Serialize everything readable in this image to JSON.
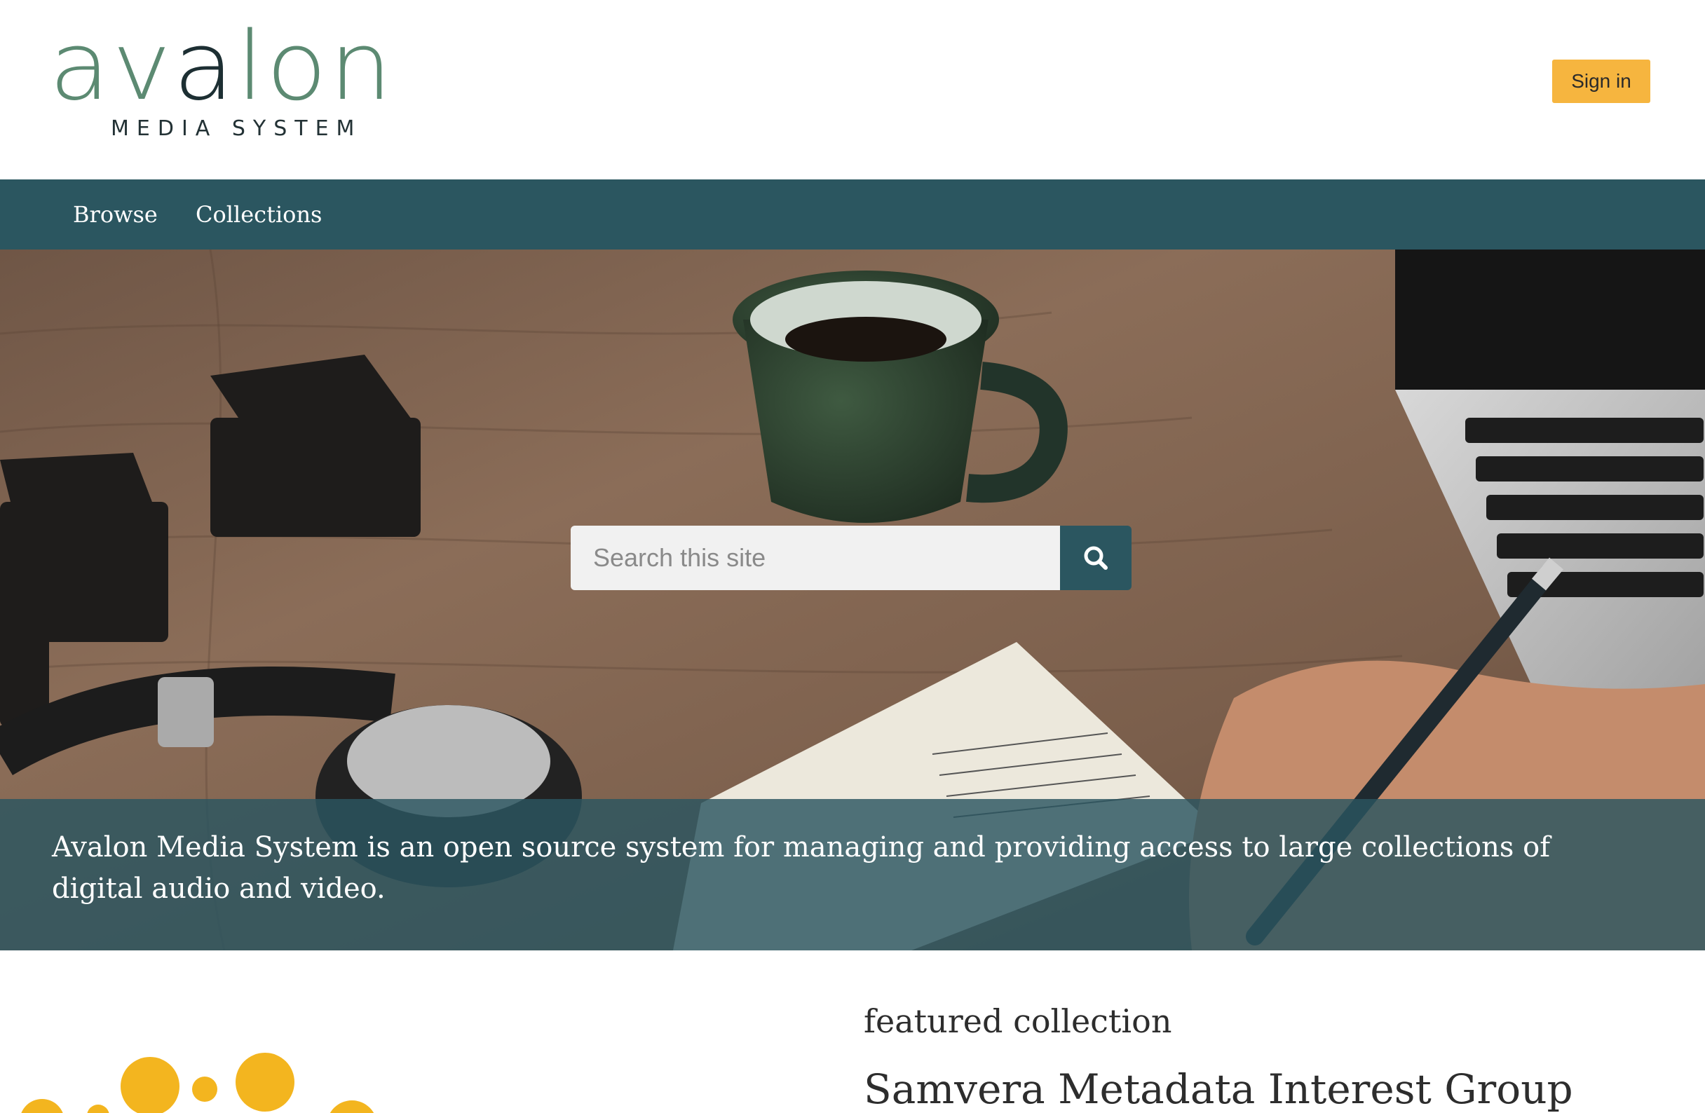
{
  "logo": {
    "word_light_1": "av",
    "word_dark": "a",
    "word_light_2": "lon",
    "subtitle": "MEDIA SYSTEM"
  },
  "header": {
    "signin_label": "Sign in"
  },
  "nav": {
    "items": [
      {
        "label": "Browse"
      },
      {
        "label": "Collections"
      }
    ]
  },
  "search": {
    "placeholder": "Search this site",
    "icon": "search-icon"
  },
  "banner": {
    "text": "Avalon Media System is an open source system for managing and providing access to large collections of digital audio and video."
  },
  "featured": {
    "label": "featured collection",
    "title": "Samvera Metadata Interest Group"
  },
  "colors": {
    "brand": "#2b5660",
    "accent": "#f6b53f",
    "logo_green": "#5c8a72",
    "samvera_yellow": "#f3b51f"
  }
}
